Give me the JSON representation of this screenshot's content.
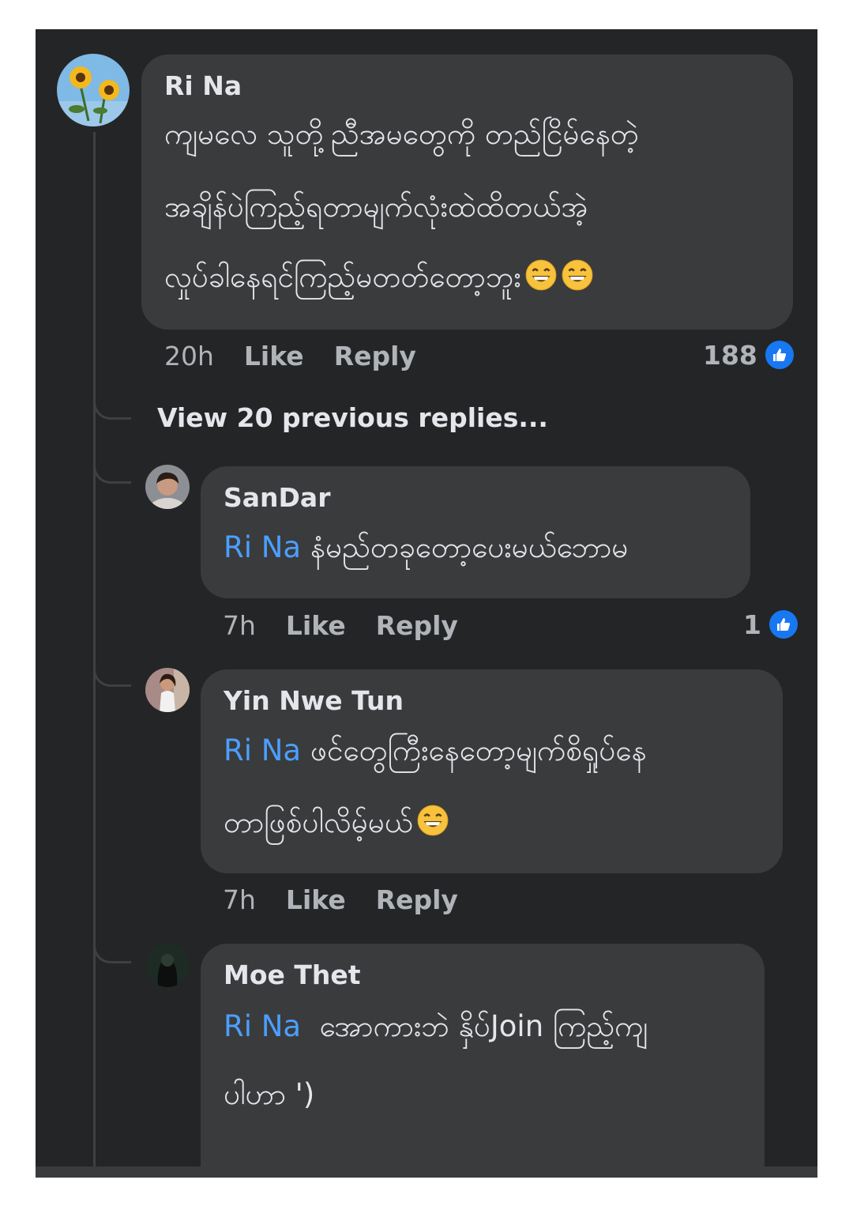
{
  "comments": [
    {
      "author": "Ri Na",
      "lines": [
        "ကျမလေ သူတို့ညီအမတွေကို တည်ငြိမ်နေတဲ့",
        "အချိန်ပဲကြည့်ရတာမျက်လုံးထဲထိတယ်အဲ့",
        "လှုပ်ခါနေရင်ကြည့်မတတ်တော့ဘူး"
      ],
      "time": "20h",
      "like_label": "Like",
      "reply_label": "Reply",
      "reaction_count": "188"
    }
  ],
  "view_more_label": "View 20 previous replies...",
  "replies": [
    {
      "author": "SanDar",
      "mention": "Ri Na",
      "lines": [
        "နံမည်တခုတော့ပေးမယ်ဘောမ"
      ],
      "time": "7h",
      "like_label": "Like",
      "reply_label": "Reply",
      "reaction_count": "1"
    },
    {
      "author": "Yin Nwe Tun",
      "mention": "Ri Na",
      "lines": [
        "ဖင်တွေကြီးနေတော့မျက်စိရှုပ်နေ",
        "တာဖြစ်ပါလိမ့်မယ်"
      ],
      "time": "7h",
      "like_label": "Like",
      "reply_label": "Reply"
    },
    {
      "author": "Moe Thet",
      "mention": "Ri Na",
      "lines": [
        "အောကားဘဲ နှိပ်Join ကြည့်ကျ",
        "ပါဟာ ')"
      ]
    }
  ],
  "icons": {
    "reaction": "like-thumb-icon",
    "emoji": "grinning-face-emoji"
  },
  "colors": {
    "background": "#242526",
    "bubble": "#3a3b3c",
    "mention": "#4b9fff",
    "like_badge": "#1877f2"
  }
}
